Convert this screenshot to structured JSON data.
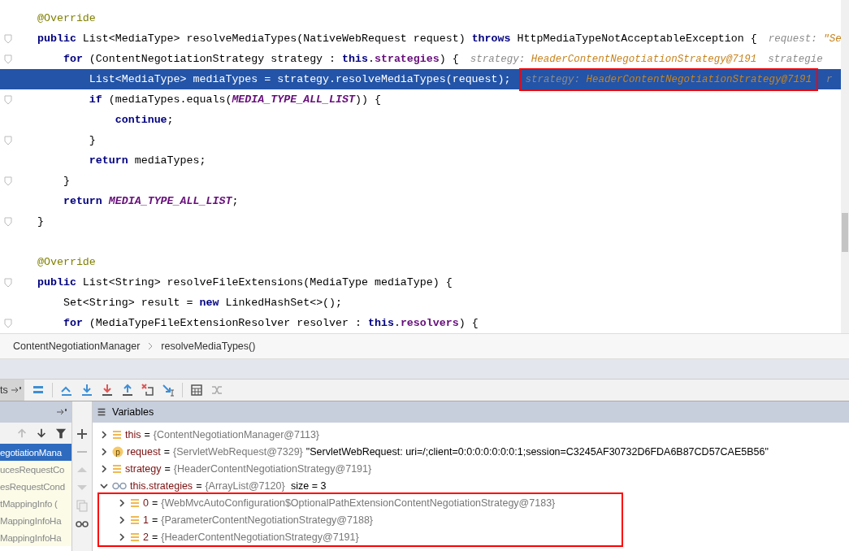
{
  "editor": {
    "lines": [
      {
        "current": false,
        "fold_marker": false,
        "tokens": [
          {
            "kind": "annotation",
            "text": "@Override"
          }
        ]
      },
      {
        "current": false,
        "fold_marker": true,
        "tokens": [
          {
            "kind": "kw",
            "text": "public"
          },
          {
            "kind": "plain",
            "text": " List<MediaType> resolveMediaTypes(NativeWebRequest request) "
          },
          {
            "kind": "kw",
            "text": "throws"
          },
          {
            "kind": "plain",
            "text": " HttpMediaTypeNotAcceptableException {"
          }
        ],
        "hints": [
          {
            "name": "request:",
            "value": "\"Se"
          }
        ]
      },
      {
        "current": false,
        "fold_marker": true,
        "tokens": [
          {
            "kind": "kw",
            "text": "    for"
          },
          {
            "kind": "plain",
            "text": " (ContentNegotiationStrategy strategy : "
          },
          {
            "kind": "kw",
            "text": "this"
          },
          {
            "kind": "plain",
            "text": "."
          },
          {
            "kind": "field",
            "text": "strategies"
          },
          {
            "kind": "plain",
            "text": ") {"
          }
        ],
        "hints": [
          {
            "name": "strategy:",
            "value": "HeaderContentNegotiationStrategy@7191"
          },
          {
            "name": "strategie"
          }
        ]
      },
      {
        "current": true,
        "fold_marker": false,
        "tokens": [
          {
            "kind": "plain",
            "text": "        List<MediaType> mediaTypes = strategy.resolveMediaTypes(request);"
          }
        ],
        "hints": [
          {
            "name": "strategy:",
            "value": "HeaderContentNegotiationStrategy@7191",
            "outlined": true
          },
          {
            "name": "r"
          }
        ]
      },
      {
        "current": false,
        "fold_marker": true,
        "tokens": [
          {
            "kind": "kw",
            "text": "        if"
          },
          {
            "kind": "plain",
            "text": " (mediaTypes.equals("
          },
          {
            "kind": "constant",
            "text": "MEDIA_TYPE_ALL_LIST"
          },
          {
            "kind": "plain",
            "text": ")) {"
          }
        ]
      },
      {
        "current": false,
        "fold_marker": false,
        "tokens": [
          {
            "kind": "kw",
            "text": "            continue"
          },
          {
            "kind": "plain",
            "text": ";"
          }
        ]
      },
      {
        "current": false,
        "fold_marker": true,
        "tokens": [
          {
            "kind": "plain",
            "text": "        }"
          }
        ]
      },
      {
        "current": false,
        "fold_marker": false,
        "tokens": [
          {
            "kind": "kw",
            "text": "        return"
          },
          {
            "kind": "plain",
            "text": " mediaTypes;"
          }
        ]
      },
      {
        "current": false,
        "fold_marker": true,
        "tokens": [
          {
            "kind": "plain",
            "text": "    }"
          }
        ]
      },
      {
        "current": false,
        "fold_marker": false,
        "tokens": [
          {
            "kind": "kw",
            "text": "    return"
          },
          {
            "kind": "constant",
            "text": " MEDIA_TYPE_ALL_LIST"
          },
          {
            "kind": "plain",
            "text": ";"
          }
        ]
      },
      {
        "current": false,
        "fold_marker": true,
        "tokens": [
          {
            "kind": "plain",
            "text": "}"
          }
        ]
      },
      {
        "current": false,
        "fold_marker": false
      },
      {
        "current": false,
        "fold_marker": false,
        "tokens": [
          {
            "kind": "annotation",
            "text": "@Override"
          }
        ]
      },
      {
        "current": false,
        "fold_marker": true,
        "tokens": [
          {
            "kind": "kw",
            "text": "public"
          },
          {
            "kind": "plain",
            "text": " List<String> resolveFileExtensions(MediaType mediaType) {"
          }
        ]
      },
      {
        "current": false,
        "fold_marker": false,
        "tokens": [
          {
            "kind": "plain",
            "text": "    Set<String> result = "
          },
          {
            "kind": "kw",
            "text": "new"
          },
          {
            "kind": "plain",
            "text": " LinkedHashSet<>();"
          }
        ]
      },
      {
        "current": false,
        "fold_marker": true,
        "tokens": [
          {
            "kind": "kw",
            "text": "    for"
          },
          {
            "kind": "plain",
            "text": " (MediaTypeFileExtensionResolver resolver : "
          },
          {
            "kind": "kw",
            "text": "this"
          },
          {
            "kind": "plain",
            "text": "."
          },
          {
            "kind": "field",
            "text": "resolvers"
          },
          {
            "kind": "plain",
            "text": ") {"
          }
        ]
      }
    ]
  },
  "breadcrumbs": [
    "ContentNegotiationManager",
    "resolveMediaTypes()"
  ],
  "debug_toolbar": {
    "tab_label": "ts"
  },
  "frames": {
    "items": [
      {
        "label": "egotiationMana",
        "selected": true
      },
      {
        "label": "ucesRequestCo",
        "selected": false
      },
      {
        "label": "esRequestCond",
        "selected": false
      },
      {
        "label": "tMappingInfo (",
        "selected": false
      },
      {
        "label": "MappingInfoHa",
        "selected": false
      },
      {
        "label": "MappingInfoHa",
        "selected": false
      }
    ]
  },
  "variables": {
    "title": "Variables",
    "items": [
      {
        "kind": "field",
        "name": "this",
        "equals": "=",
        "value": "{ContentNegotiationManager@7113}",
        "expanded": false
      },
      {
        "kind": "param",
        "badge": "p",
        "name": "request",
        "equals": "=",
        "value": "{ServletWebRequest@7329}",
        "string_value": "\"ServletWebRequest: uri=/;client=0:0:0:0:0:0:0:1;session=C3245AF30732D6FDA6B87CD57CAE5B56\"",
        "expanded": false
      },
      {
        "kind": "field",
        "name": "strategy",
        "equals": "=",
        "value": "{HeaderContentNegotiationStrategy@7191}",
        "expanded": false
      },
      {
        "kind": "watch",
        "name": "this.strategies",
        "equals": "=",
        "value": "{ArrayList@7120}",
        "size": "size = 3",
        "expanded": true,
        "children_outlined": true,
        "children": [
          {
            "kind": "field",
            "name": "0",
            "equals": "=",
            "value": "{WebMvcAutoConfiguration$OptionalPathExtensionContentNegotiationStrategy@7183}",
            "expanded": false
          },
          {
            "kind": "field",
            "name": "1",
            "equals": "=",
            "value": "{ParameterContentNegotiationStrategy@7188}",
            "expanded": false
          },
          {
            "kind": "field",
            "name": "2",
            "equals": "=",
            "value": "{HeaderContentNegotiationStrategy@7191}",
            "expanded": false
          }
        ]
      }
    ]
  }
}
